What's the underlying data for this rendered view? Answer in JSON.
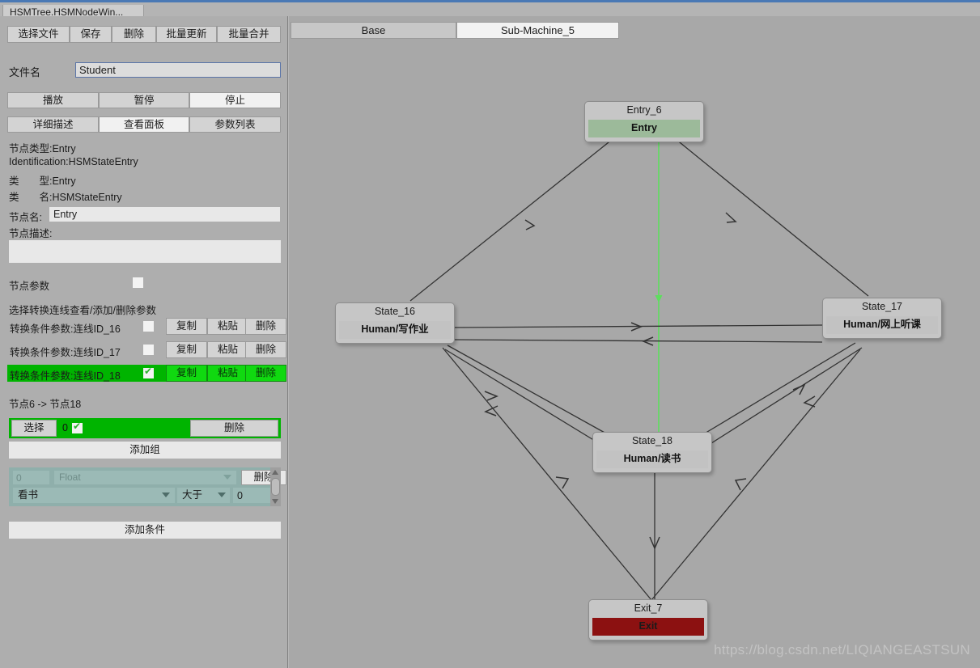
{
  "window": {
    "tab_title": "HSMTree.HSMNodeWin..."
  },
  "toolbar": {
    "select_file": "选择文件",
    "save": "保存",
    "delete": "删除",
    "batch_update": "批量更新",
    "batch_merge": "批量合并"
  },
  "file": {
    "label": "文件名",
    "value": "Student"
  },
  "playback": {
    "play": "播放",
    "pause": "暂停",
    "stop": "停止"
  },
  "panel_tabs": [
    {
      "label": "详细描述",
      "active": false
    },
    {
      "label": "查看面板",
      "active": true
    },
    {
      "label": "参数列表",
      "active": false
    }
  ],
  "inspector": {
    "node_type_line": "节点类型:Entry",
    "identification_line": "Identification:HSMStateEntry",
    "class_type_line": "类　　型:Entry",
    "class_name_line": "类　　名:HSMStateEntry",
    "node_name_label": "节点名:",
    "node_name_value": "Entry",
    "node_desc_label": "节点描述:",
    "node_desc_value": "",
    "node_param_label": "节点参数",
    "node_param_checked": false,
    "select_transition_hint": "选择转换连线查看/添加/删除参数"
  },
  "transitions": [
    {
      "label": "转换条件参数:连线ID_16",
      "checked": false,
      "copy": "复制",
      "paste": "粘贴",
      "delete": "删除",
      "selected": false
    },
    {
      "label": "转换条件参数:连线ID_17",
      "checked": false,
      "copy": "复制",
      "paste": "粘贴",
      "delete": "删除",
      "selected": false
    },
    {
      "label": "转换条件参数:连线ID_18",
      "checked": true,
      "copy": "复制",
      "paste": "粘贴",
      "delete": "删除",
      "selected": true
    }
  ],
  "transition_detail": {
    "node_pair": "节点6 -> 节点18",
    "group_select": "选择",
    "group_index": "0",
    "group_checked": true,
    "group_delete": "删除",
    "add_group": "添加组",
    "add_condition": "添加条件"
  },
  "condition": {
    "index": "0",
    "type": "Float",
    "delete": "删除",
    "parameter": "看书",
    "operator": "大于",
    "value": "0"
  },
  "graph": {
    "tabs": [
      {
        "label": "Base",
        "active": false
      },
      {
        "label": "Sub-Machine_5",
        "active": true
      }
    ],
    "nodes": [
      {
        "id": "entry6",
        "title": "Entry_6",
        "body": "Entry",
        "kind": "entry"
      },
      {
        "id": "state16",
        "title": "State_16",
        "body": "Human/写作业",
        "kind": "state"
      },
      {
        "id": "state17",
        "title": "State_17",
        "body": "Human/网上听课",
        "kind": "state"
      },
      {
        "id": "state18",
        "title": "State_18",
        "body": "Human/读书",
        "kind": "state"
      },
      {
        "id": "exit7",
        "title": "Exit_7",
        "body": "Exit",
        "kind": "exit"
      }
    ],
    "edges": [
      {
        "from": "entry6",
        "to": "state16",
        "highlight": false
      },
      {
        "from": "entry6",
        "to": "state17",
        "highlight": false
      },
      {
        "from": "entry6",
        "to": "state18",
        "highlight": true
      },
      {
        "from": "state16",
        "to": "state17",
        "highlight": false
      },
      {
        "from": "state17",
        "to": "state16",
        "highlight": false
      },
      {
        "from": "state16",
        "to": "state18",
        "highlight": false
      },
      {
        "from": "state18",
        "to": "state16",
        "highlight": false
      },
      {
        "from": "state18",
        "to": "state17",
        "highlight": false
      },
      {
        "from": "state17",
        "to": "state18",
        "highlight": false
      },
      {
        "from": "state16",
        "to": "exit7",
        "highlight": false
      },
      {
        "from": "state17",
        "to": "exit7",
        "highlight": false
      },
      {
        "from": "state18",
        "to": "exit7",
        "highlight": false
      }
    ]
  },
  "watermark": "https://blog.csdn.net/LIQIANGEASTSUN",
  "colors": {
    "selected_green": "#00b400",
    "button_green": "#10d910",
    "entry_body": "#9cba9a",
    "exit_body": "#8c1111",
    "highlight_edge": "#5ede5e",
    "panel_bg": "#aeaeae",
    "graph_bg": "#a8a8a8",
    "condition_bg": "#8fafab"
  }
}
